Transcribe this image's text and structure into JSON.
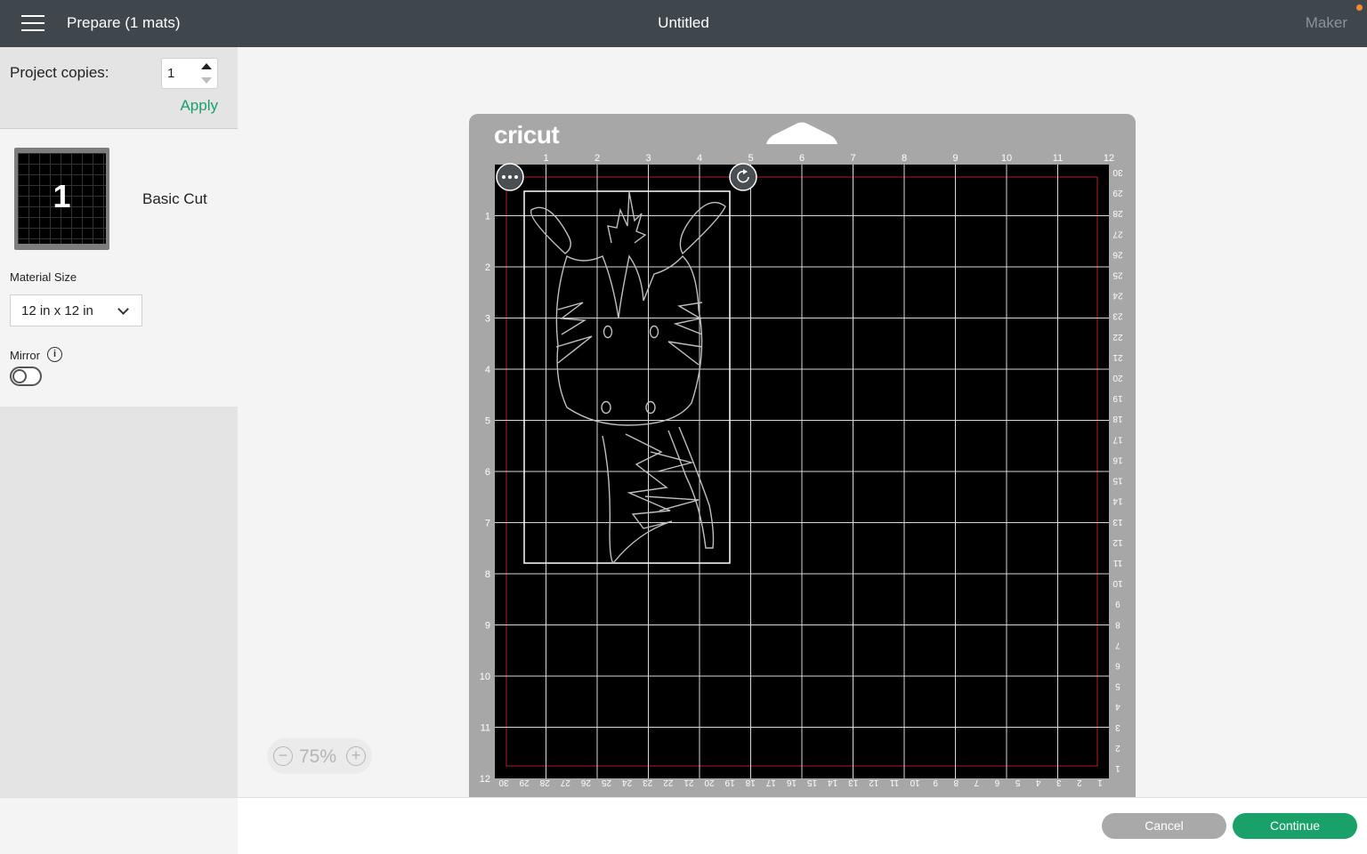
{
  "header": {
    "title": "Prepare (1 mats)",
    "document_title": "Untitled",
    "machine": "Maker"
  },
  "copies": {
    "label": "Project copies:",
    "value": "1",
    "apply_label": "Apply"
  },
  "mat": {
    "number": "1",
    "name": "Basic Cut",
    "brand": "cricut"
  },
  "material_size": {
    "label": "Material Size",
    "value": "12 in x 12 in"
  },
  "mirror": {
    "label": "Mirror",
    "enabled": false
  },
  "zoom": {
    "value": "75%"
  },
  "ruler": {
    "top": [
      "1",
      "2",
      "3",
      "4",
      "5",
      "6",
      "7",
      "8",
      "9",
      "10",
      "11",
      "12"
    ],
    "left": [
      "1",
      "2",
      "3",
      "4",
      "5",
      "6",
      "7",
      "8",
      "9",
      "10",
      "11",
      "12"
    ],
    "right_cm": [
      "30",
      "29",
      "28",
      "27",
      "26",
      "25",
      "24",
      "23",
      "22",
      "21",
      "20",
      "19",
      "18",
      "17",
      "16",
      "15",
      "14",
      "13",
      "12",
      "11",
      "10",
      "9",
      "8",
      "7",
      "6",
      "5",
      "4",
      "3",
      "2",
      "1"
    ],
    "bottom_cm": [
      "30",
      "29",
      "28",
      "27",
      "26",
      "25",
      "24",
      "23",
      "22",
      "21",
      "20",
      "19",
      "18",
      "17",
      "16",
      "15",
      "14",
      "13",
      "12",
      "11",
      "10",
      "9",
      "8",
      "7",
      "6",
      "5",
      "4",
      "3",
      "2",
      "1"
    ]
  },
  "footer": {
    "cancel_label": "Cancel",
    "continue_label": "Continue"
  },
  "colors": {
    "topbar": "#3f474d",
    "accent": "#1aa16a",
    "mat": "#a7a7a7",
    "mat_grid": "#000000",
    "margin_line": "#b01e1e"
  }
}
